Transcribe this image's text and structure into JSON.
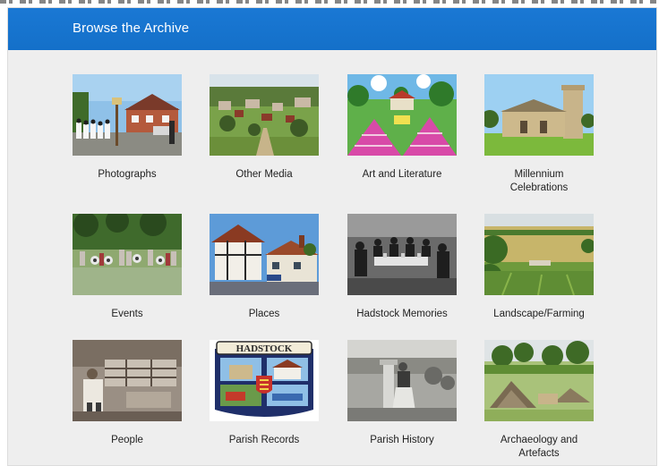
{
  "header": {
    "title": "Browse the Archive"
  },
  "categories": [
    {
      "label": "Photographs",
      "icon": "photographs-thumbnail"
    },
    {
      "label": "Other Media",
      "icon": "other-media-thumbnail"
    },
    {
      "label": "Art and Literature",
      "icon": "art-literature-thumbnail"
    },
    {
      "label": "Millennium Celebrations",
      "icon": "millennium-thumbnail"
    },
    {
      "label": "Events",
      "icon": "events-thumbnail"
    },
    {
      "label": "Places",
      "icon": "places-thumbnail"
    },
    {
      "label": "Hadstock Memories",
      "icon": "memories-thumbnail"
    },
    {
      "label": "Landscape/Farming",
      "icon": "landscape-thumbnail"
    },
    {
      "label": "People",
      "icon": "people-thumbnail"
    },
    {
      "label": "Parish Records",
      "icon": "parish-records-thumbnail"
    },
    {
      "label": "Parish History",
      "icon": "parish-history-thumbnail"
    },
    {
      "label": "Archaeology and Artefacts",
      "icon": "archaeology-thumbnail"
    }
  ],
  "thumbnail_text": {
    "parish_records_sign": "HADSTOCK"
  },
  "colors": {
    "header": "#1976d2",
    "panel": "#eeeeee",
    "caption_text": "#222222"
  }
}
